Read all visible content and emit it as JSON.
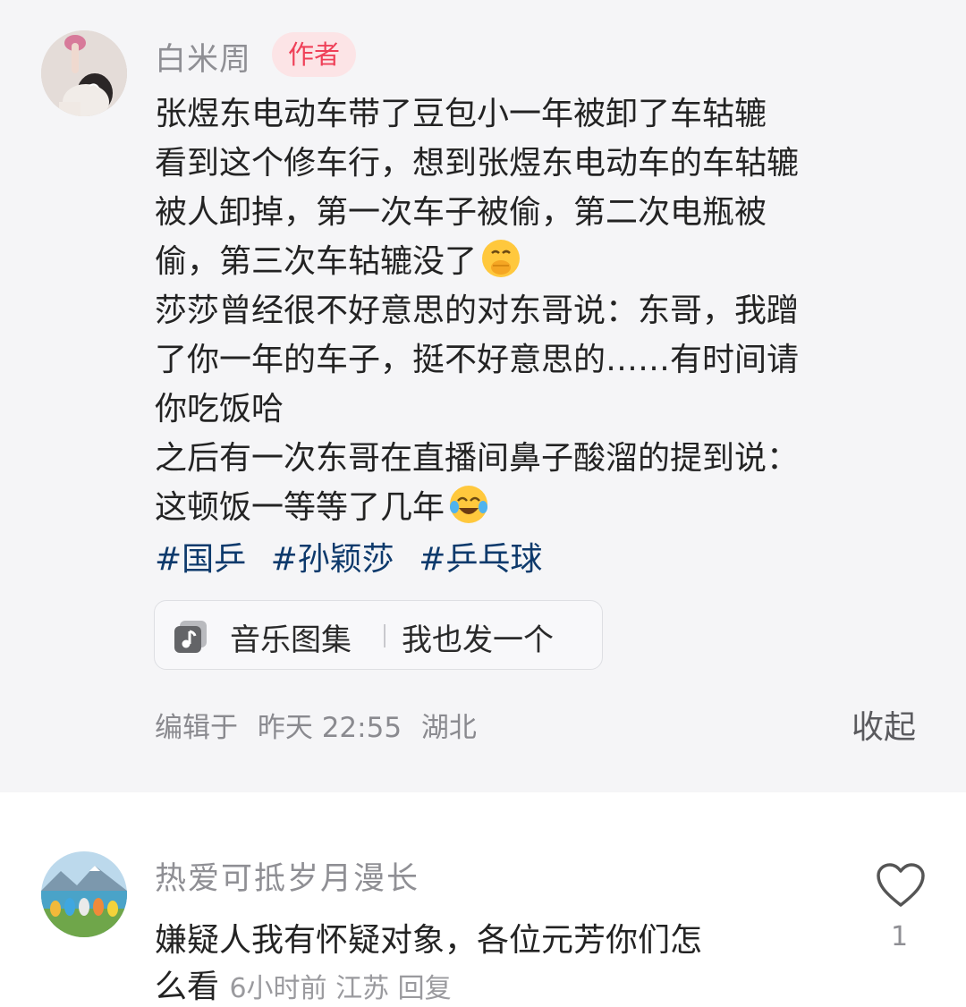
{
  "post": {
    "author": "白米周",
    "author_badge": "作者",
    "lines": [
      "张煜东电动车带了豆包小一年被卸了车轱辘",
      "看到这个修车行，想到张煜东电动车的车轱辘",
      "被人卸掉，第一次车子被偷，第二次电瓶被",
      "偷，第三次车轱辘没了",
      "莎莎曾经很不好意思的对东哥说：东哥，我蹭",
      "了你一年的车子，挺不好意思的……有时间请",
      "你吃饭哈",
      "之后有一次东哥在直播间鼻子酸溜的提到说：",
      "这顿饭一等等了几年"
    ],
    "emoji_1": "face-with-hand-over-mouth",
    "emoji_2": "face-with-tears-of-joy",
    "tags": [
      "#国乒",
      "#孙颖莎",
      "#乒乓球"
    ],
    "music": {
      "label": "音乐图集",
      "action": "我也发一个"
    },
    "meta": {
      "edited": "编辑于",
      "time": "昨天 22:55",
      "location": "湖北"
    },
    "collapse_label": "收起"
  },
  "comment": {
    "username": "热爱可抵岁月漫长",
    "text": "嫌疑人我有怀疑对象，各位元芳你们怎",
    "text_line2": "么看",
    "meta_partial": "6小时前 江苏 回复",
    "like_count": "1"
  },
  "colors": {
    "post_bg": "#f5f5f7",
    "badge_bg": "#fce4e6",
    "badge_text": "#ef4058",
    "tag_text": "#0e3a6c"
  }
}
